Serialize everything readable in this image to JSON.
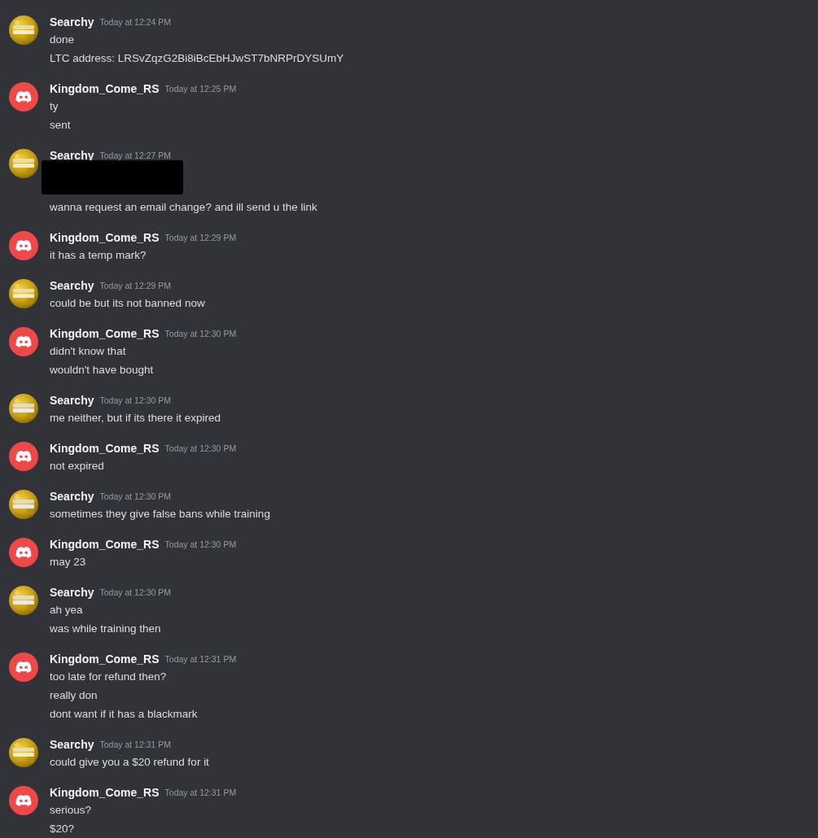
{
  "messages": [
    {
      "author": "Searchy",
      "avatar": {
        "kind": "picture"
      },
      "time": "Today at 12:24 PM",
      "lines": [
        {
          "kind": "text",
          "text": "done"
        },
        {
          "kind": "text",
          "text": "LTC address: LRSvZqzG2Bi8iBcEbHJwST7bNRPrDYSUmY"
        }
      ]
    },
    {
      "author": "Kingdom_Come_RS",
      "avatar": {
        "kind": "logo"
      },
      "time": "Today at 12:25 PM",
      "lines": [
        {
          "kind": "text",
          "text": "ty"
        },
        {
          "kind": "text",
          "text": "sent"
        }
      ]
    },
    {
      "author": "Searchy",
      "avatar": {
        "kind": "picture"
      },
      "time": "Today at 12:27 PM",
      "lines": [
        {
          "kind": "redacted"
        },
        {
          "kind": "text",
          "text": "wanna request an email change? and ill send u the link"
        }
      ]
    },
    {
      "author": "Kingdom_Come_RS",
      "avatar": {
        "kind": "logo"
      },
      "time": "Today at 12:29 PM",
      "lines": [
        {
          "kind": "text",
          "text": "it has a temp mark?"
        }
      ]
    },
    {
      "author": "Searchy",
      "avatar": {
        "kind": "picture"
      },
      "time": "Today at 12:29 PM",
      "lines": [
        {
          "kind": "text",
          "text": "could be but its not banned now"
        }
      ]
    },
    {
      "author": "Kingdom_Come_RS",
      "avatar": {
        "kind": "logo"
      },
      "time": "Today at 12:30 PM",
      "lines": [
        {
          "kind": "text",
          "text": "didn't know that"
        },
        {
          "kind": "text",
          "text": "wouldn't have bought"
        }
      ]
    },
    {
      "author": "Searchy",
      "avatar": {
        "kind": "picture"
      },
      "time": "Today at 12:30 PM",
      "lines": [
        {
          "kind": "text",
          "text": "me neither, but if its there it expired"
        }
      ]
    },
    {
      "author": "Kingdom_Come_RS",
      "avatar": {
        "kind": "logo"
      },
      "time": "Today at 12:30 PM",
      "lines": [
        {
          "kind": "text",
          "text": "not expired"
        }
      ]
    },
    {
      "author": "Searchy",
      "avatar": {
        "kind": "picture"
      },
      "time": "Today at 12:30 PM",
      "lines": [
        {
          "kind": "text",
          "text": "sometimes they give false bans while training"
        }
      ]
    },
    {
      "author": "Kingdom_Come_RS",
      "avatar": {
        "kind": "logo"
      },
      "time": "Today at 12:30 PM",
      "lines": [
        {
          "kind": "text",
          "text": "may 23"
        }
      ]
    },
    {
      "author": "Searchy",
      "avatar": {
        "kind": "picture"
      },
      "time": "Today at 12:30 PM",
      "lines": [
        {
          "kind": "text",
          "text": "ah yea"
        },
        {
          "kind": "text",
          "text": "was while training then"
        }
      ]
    },
    {
      "author": "Kingdom_Come_RS",
      "avatar": {
        "kind": "logo"
      },
      "time": "Today at 12:31 PM",
      "lines": [
        {
          "kind": "text",
          "text": "too late for refund then?"
        },
        {
          "kind": "text",
          "text": "really don"
        },
        {
          "kind": "text",
          "text": "dont want if it has a blackmark"
        }
      ]
    },
    {
      "author": "Searchy",
      "avatar": {
        "kind": "picture"
      },
      "time": "Today at 12:31 PM",
      "lines": [
        {
          "kind": "text",
          "text": "could give you a $20 refund for it"
        }
      ]
    },
    {
      "author": "Kingdom_Come_RS",
      "avatar": {
        "kind": "logo"
      },
      "time": "Today at 12:31 PM",
      "lines": [
        {
          "kind": "text",
          "text": "serious?"
        },
        {
          "kind": "text",
          "text": "$20?"
        }
      ]
    }
  ]
}
